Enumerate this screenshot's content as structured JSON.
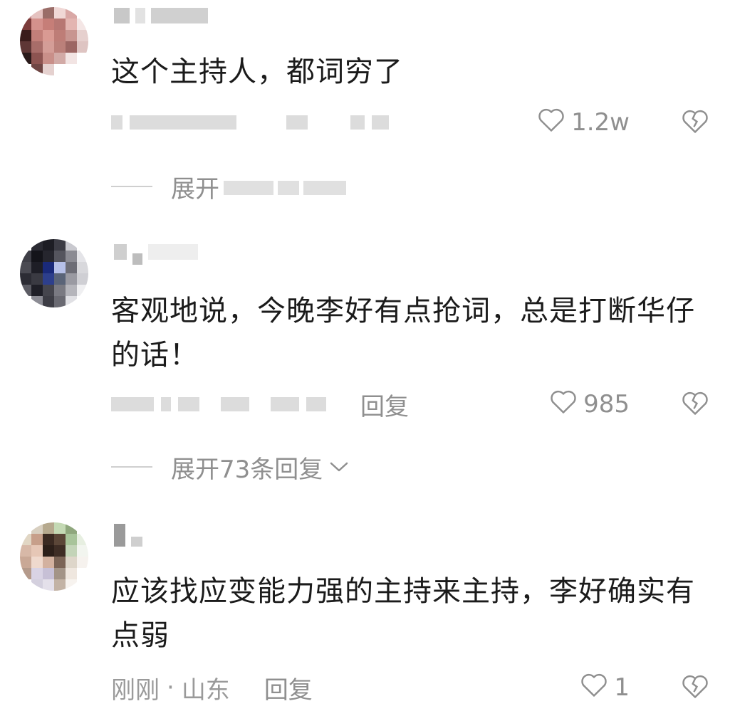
{
  "comments": [
    {
      "text": "这个主持人，都词穷了",
      "likes": "1.2w",
      "expand_label": "展开"
    },
    {
      "text": "客观地说，今晚李好有点抢词，总是打断华仔的话！",
      "reply_label": "回复",
      "likes": "985",
      "expand_label": "展开73条回复"
    },
    {
      "text": "应该找应变能力强的主持来主持，李好确实有点弱",
      "time": "刚刚",
      "separator": "·",
      "location": "山东",
      "reply_label": "回复",
      "likes": "1"
    }
  ],
  "icons": {
    "like": "heart-outline-icon",
    "dislike": "broken-heart-icon",
    "expand": "chevron-down-icon"
  },
  "colors": {
    "text": "#1b1b1b",
    "meta": "#9a9a9a",
    "background": "#ffffff"
  }
}
